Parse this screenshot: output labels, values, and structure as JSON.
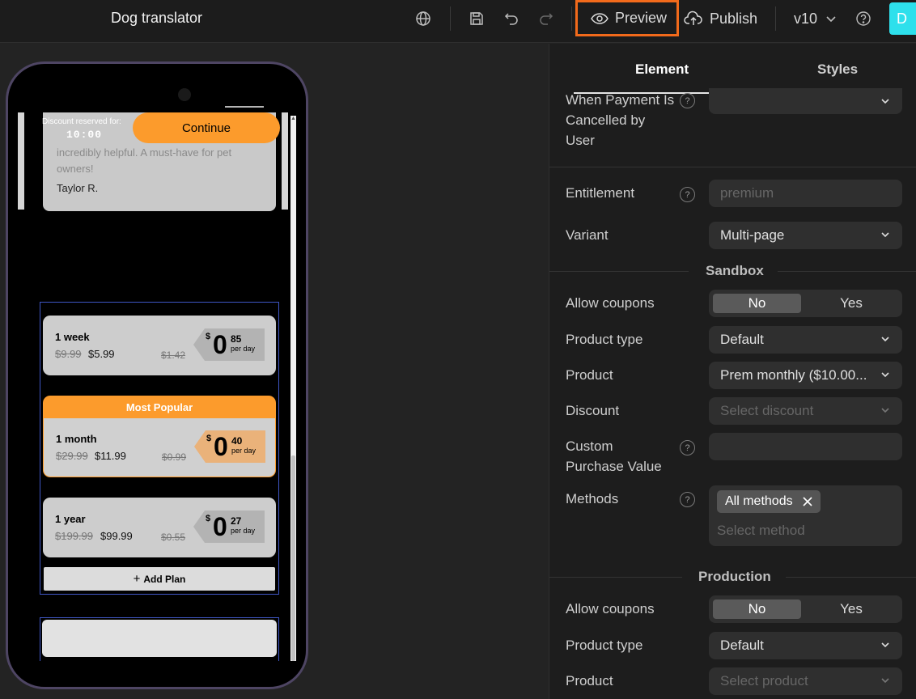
{
  "header": {
    "app_title": "Dog translator",
    "preview_label": "Preview",
    "publish_label": "Publish",
    "version": "v10",
    "avatar_letter": "D"
  },
  "phone": {
    "review_text": "incredibly helpful. A must-have for pet owners!",
    "review_author": "Taylor R.",
    "discount_label": "Discount reserved for:",
    "timer": "10:00",
    "continue_label": "Continue",
    "popular_label": "Most Popular",
    "add_plan_label": "Add Plan",
    "plans": [
      {
        "name": "1 week",
        "old_price": "$9.99",
        "new_price": "$5.99",
        "old_daily": "$1.42",
        "currency": "$",
        "int": "0",
        "cents": "85",
        "per": "per day"
      },
      {
        "name": "1 month",
        "old_price": "$29.99",
        "new_price": "$11.99",
        "old_daily": "$0.99",
        "currency": "$",
        "int": "0",
        "cents": "40",
        "per": "per day"
      },
      {
        "name": "1 year",
        "old_price": "$199.99",
        "new_price": "$99.99",
        "old_daily": "$0.55",
        "currency": "$",
        "int": "0",
        "cents": "27",
        "per": "per day"
      }
    ]
  },
  "panel": {
    "tabs": [
      "Element",
      "Styles"
    ],
    "cancel_label": "When Payment Is Cancelled by User",
    "entitlement_label": "Entitlement",
    "entitlement_placeholder": "premium",
    "variant_label": "Variant",
    "variant_value": "Multi-page",
    "sandbox_title": "Sandbox",
    "production_title": "Production",
    "allow_coupons_label": "Allow coupons",
    "toggle_no": "No",
    "toggle_yes": "Yes",
    "product_type_label": "Product type",
    "product_type_value": "Default",
    "product_label": "Product",
    "product_value": "Prem monthly ($10.00...",
    "product_placeholder": "Select product",
    "discount_label": "Discount",
    "discount_placeholder": "Select discount",
    "custom_value_label": "Custom Purchase Value",
    "methods_label": "Methods",
    "methods_chip": "All methods",
    "methods_placeholder": "Select method"
  },
  "colors": {
    "accent_orange": "#fc9b2c",
    "highlight": "#f26a1b",
    "avatar": "#2ee0ec",
    "selection_blue": "#3f56c4"
  }
}
